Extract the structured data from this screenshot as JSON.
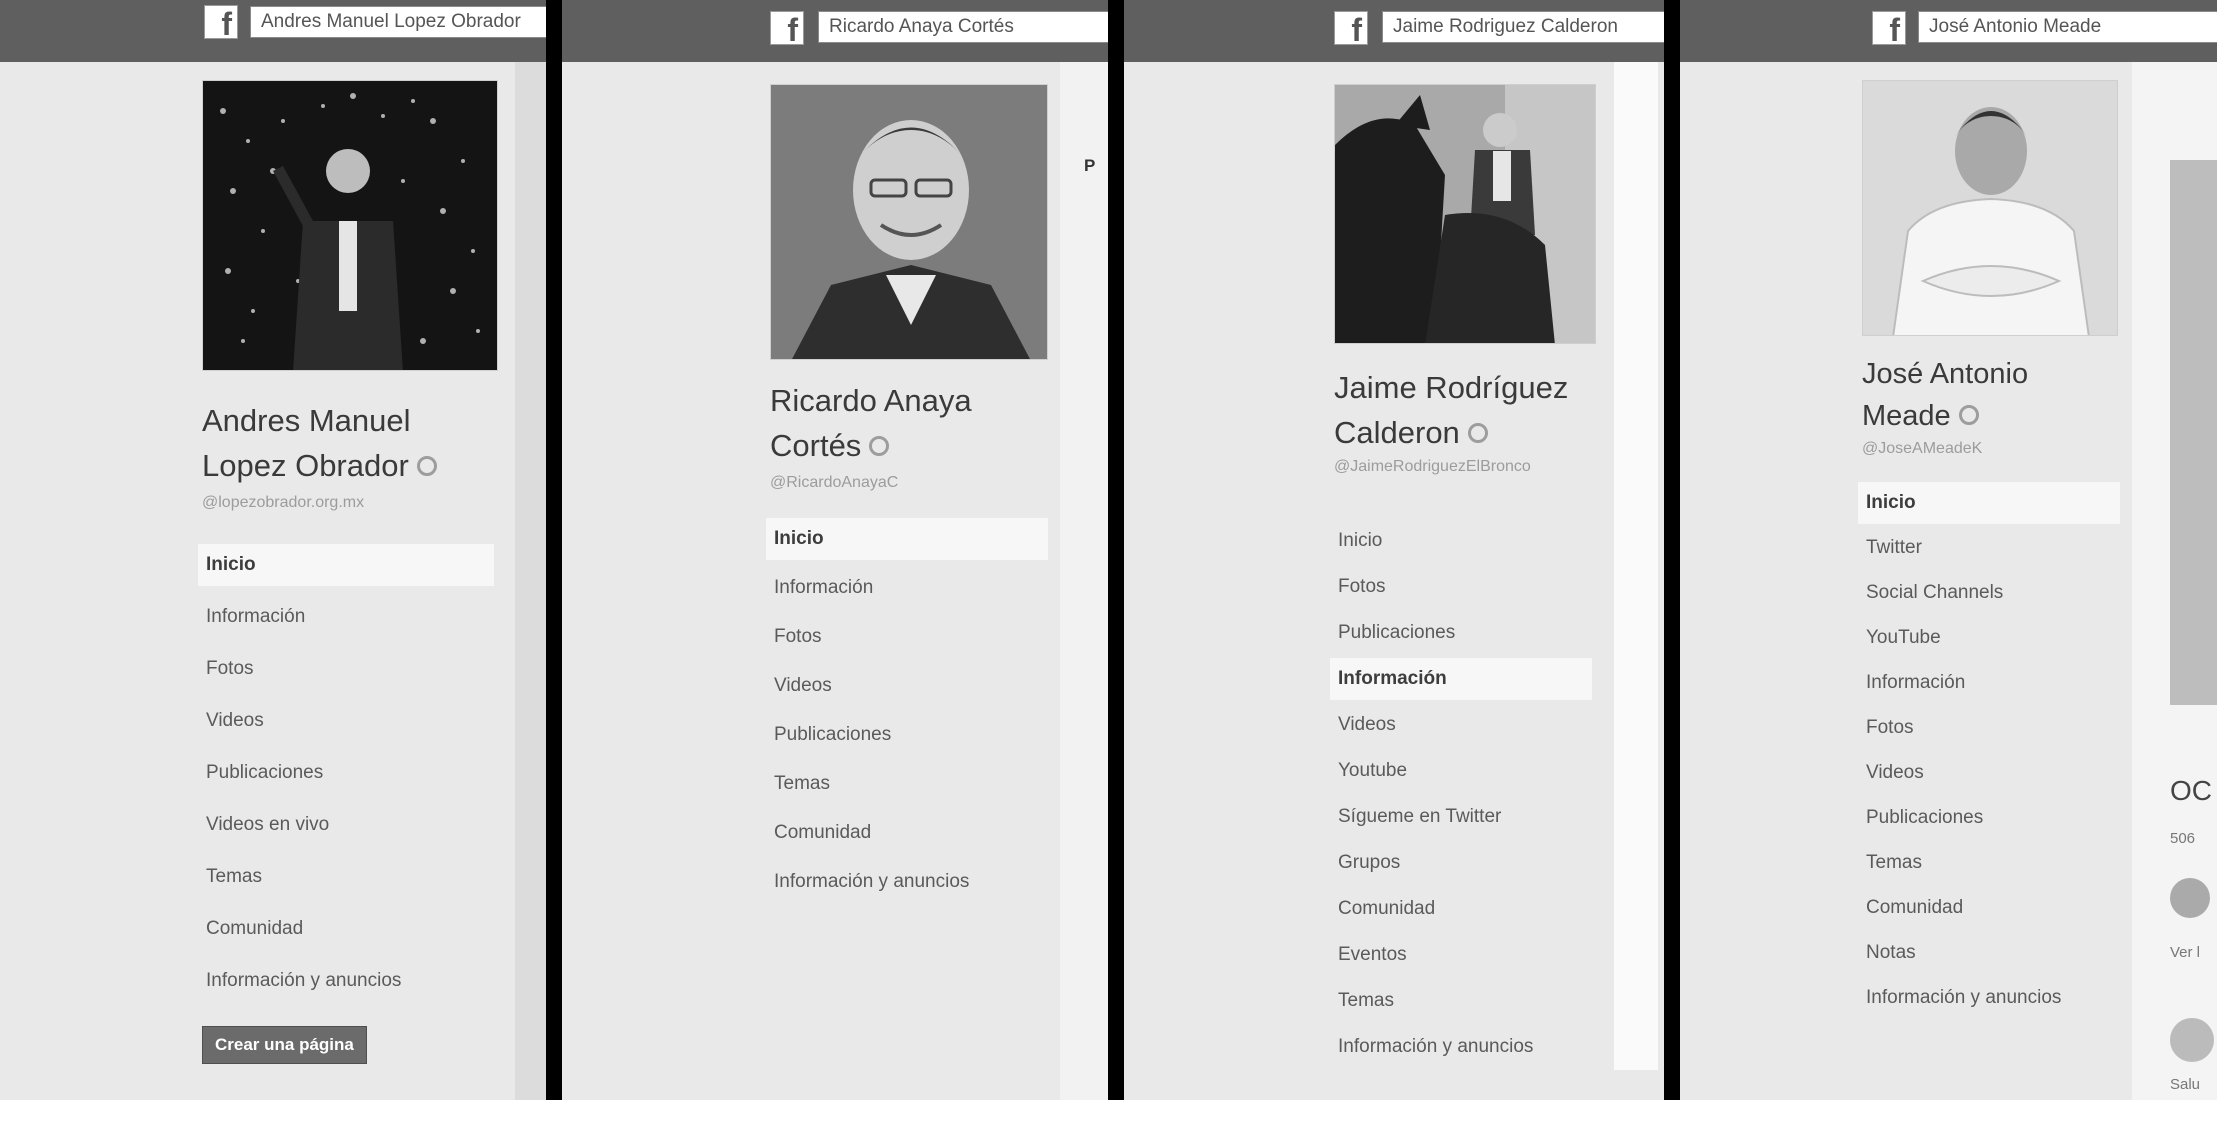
{
  "panels": [
    {
      "search": "Andres Manuel Lopez Obrador",
      "name_line1": "Andres Manuel",
      "name_line2": "Lopez Obrador",
      "handle": "@lopezobrador.org.mx",
      "menu": [
        "Inicio",
        "Información",
        "Fotos",
        "Videos",
        "Publicaciones",
        "Videos en vivo",
        "Temas",
        "Comunidad",
        "Información y anuncios"
      ],
      "active": "Inicio",
      "button": "Crear una página"
    },
    {
      "search": "Ricardo Anaya Cortés",
      "name_line1": "Ricardo Anaya",
      "name_line2": "Cortés",
      "handle": "@RicardoAnayaC",
      "menu": [
        "Inicio",
        "Información",
        "Fotos",
        "Videos",
        "Publicaciones",
        "Temas",
        "Comunidad",
        "Información y anuncios"
      ],
      "active": "Inicio",
      "side_label": "P"
    },
    {
      "search": "Jaime Rodriguez Calderon",
      "name_line1": "Jaime Rodríguez",
      "name_line2": "Calderon",
      "handle": "@JaimeRodriguezElBronco",
      "menu": [
        "Inicio",
        "Fotos",
        "Publicaciones",
        "Información",
        "Videos",
        "Youtube",
        "Sígueme en Twitter",
        "Grupos",
        "Comunidad",
        "Eventos",
        "Temas",
        "Información y anuncios"
      ],
      "active": "Información"
    },
    {
      "search": "José Antonio Meade",
      "name_line1": "José Antonio",
      "name_line2": "Meade",
      "handle": "@JoseAMeadeK",
      "menu": [
        "Inicio",
        "Twitter",
        "Social Channels",
        "YouTube",
        "Información",
        "Fotos",
        "Videos",
        "Publicaciones",
        "Temas",
        "Comunidad",
        "Notas",
        "Información y anuncios"
      ],
      "active": "Inicio",
      "side_heading": "OC",
      "side_count": "506",
      "side_link": "Ver l",
      "side_text": "Salu"
    }
  ],
  "icons": {
    "logo": "facebook-logo-icon",
    "verified": "verified-badge-icon",
    "photo": "profile-photo"
  },
  "colors": {
    "topbar": "#5f5f5f",
    "background": "#e9e9e9",
    "button": "#6b6b6b"
  }
}
